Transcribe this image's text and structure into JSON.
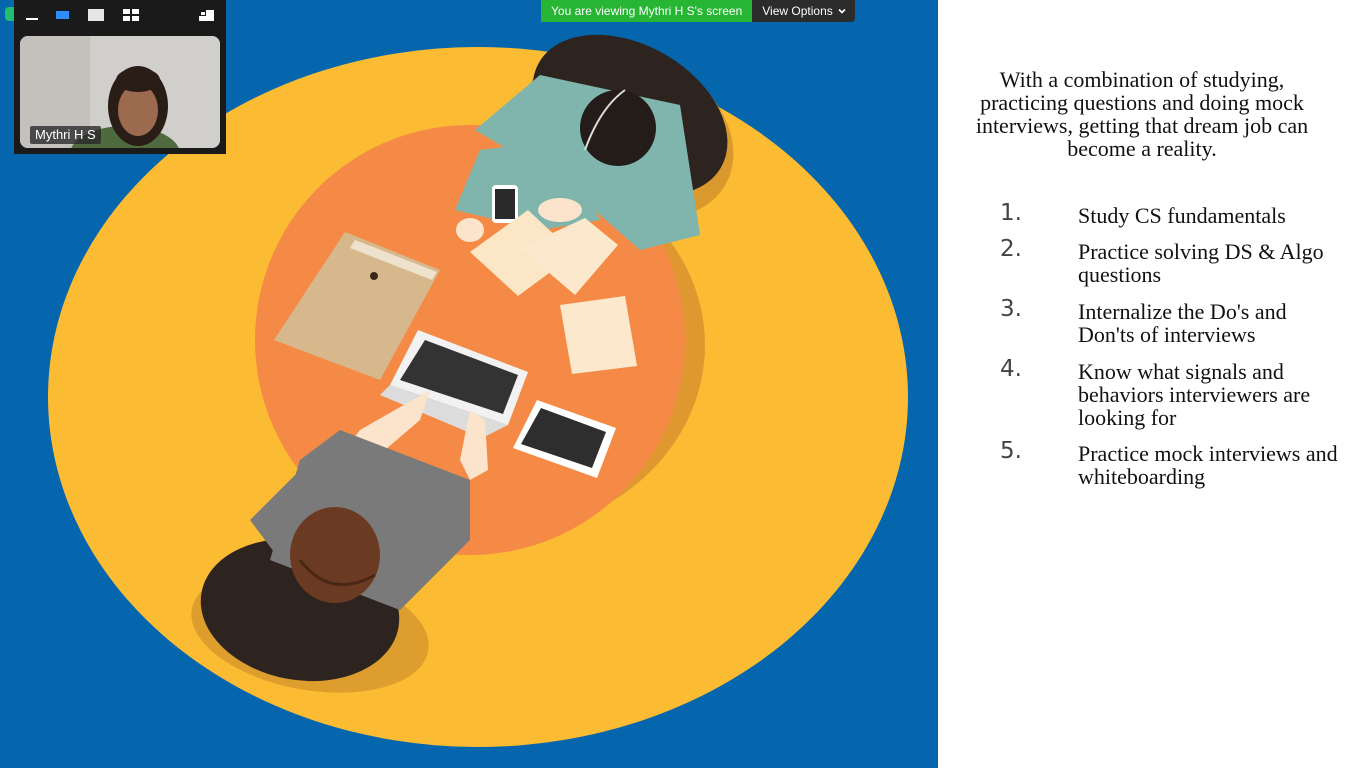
{
  "banner": {
    "viewing_text": "You are viewing Mythri H S's screen",
    "view_options_label": "View Options",
    "view_options_icon": "chevron-down-icon",
    "colors": {
      "viewing_bg": "#27b534",
      "options_bg": "#2b2b2b"
    }
  },
  "video_panel": {
    "toolbar": [
      {
        "icon": "minimize-icon"
      },
      {
        "icon": "active-speaker-view-icon"
      },
      {
        "icon": "video-only-view-icon"
      },
      {
        "icon": "gallery-view-icon"
      },
      {
        "icon": "exit-fullscreen-icon"
      }
    ],
    "participant_name": "Mythri H S"
  },
  "slide": {
    "intro": "With a combination of studying, practicing questions and doing mock interviews, getting that dream job can become a reality.",
    "steps": [
      {
        "number": "1.",
        "text": "Study CS fundamentals"
      },
      {
        "number": "2.",
        "text": "Practice solving DS & Algo questions"
      },
      {
        "number": "3.",
        "text": "Internalize the Do's and Don'ts of interviews"
      },
      {
        "number": "4.",
        "text": "Know what signals and behaviors interviewers are looking for"
      },
      {
        "number": "5.",
        "text": "Practice mock interviews and whiteboarding"
      }
    ],
    "colors": {
      "background": "#0565ad",
      "oval": "#fbbc33",
      "table": "#f58a47"
    }
  }
}
